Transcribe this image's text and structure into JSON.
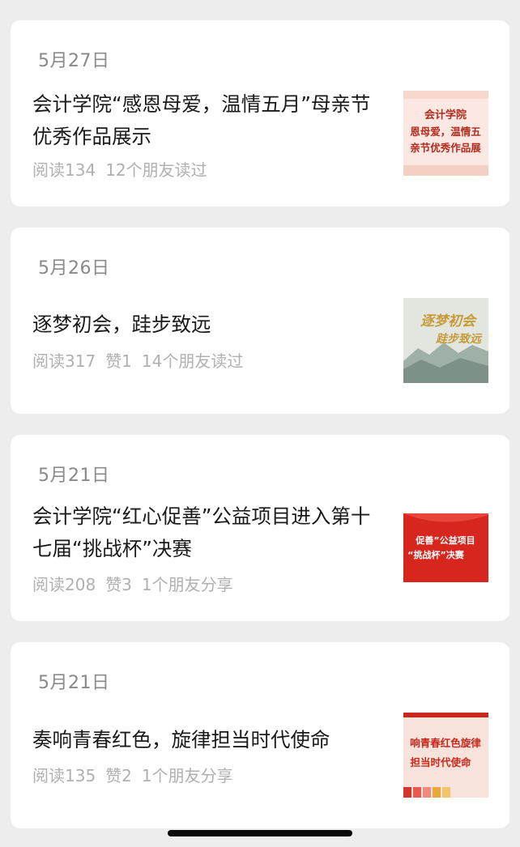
{
  "articles": [
    {
      "date": "5月27日",
      "title": "会计学院“感恩母爱，温情五月”母亲节优秀作品展示",
      "reads": "阅读134",
      "likes": "",
      "friends": "12个朋友读过",
      "thumb_text": [
        "会计学院",
        "恩母爱，温情五",
        "亲节优秀作品展"
      ],
      "thumb_colors": {
        "bg": "#fbe8e2",
        "text": "#b32a1e"
      }
    },
    {
      "date": "5月26日",
      "title": "逐梦初会，跬步致远",
      "reads": "阅读317",
      "likes": "赞1",
      "friends": "14个朋友读过",
      "thumb_text": [
        "逐梦初会",
        "跬步致远"
      ],
      "thumb_colors": {
        "bg": "#e3e6df",
        "text": "#c79a3a"
      }
    },
    {
      "date": "5月21日",
      "title": "会计学院“红心促善”公益项目进入第十七届“挑战杯”决赛",
      "reads": "阅读208",
      "likes": "赞3",
      "friends": "1个朋友分享",
      "thumb_text": [
        "促善”公益项目",
        "“挑战杯”决赛"
      ],
      "thumb_colors": {
        "bg": "#d7261e",
        "text": "#ffffff"
      }
    },
    {
      "date": "5月21日",
      "title": "奏响青春红色，旋律担当时代使命",
      "reads": "阅读135",
      "likes": "赞2",
      "friends": "1个朋友分享",
      "thumb_text": [
        "响青春红色旋律",
        "担当时代使命"
      ],
      "thumb_colors": {
        "bg": "#f7e3dc",
        "text": "#c8281c"
      }
    }
  ]
}
